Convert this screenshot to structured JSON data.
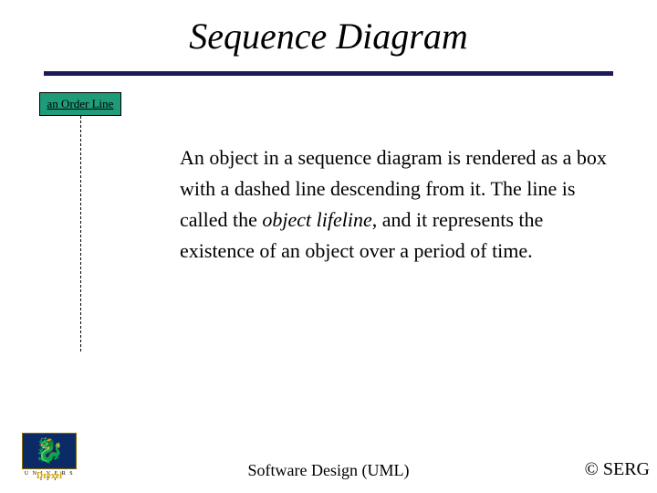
{
  "title": "Sequence Diagram",
  "object_box": {
    "label": "an Order Line"
  },
  "body": {
    "t1": "An object in a sequence diagram is rendered as a box with a dashed line descending from it. The line is called the ",
    "italic": "object lifeline",
    "t2": ", and it represents the existence of an object over a period of time."
  },
  "footer": {
    "center": "Software Design (UML)",
    "right": "© SERG"
  },
  "logo": {
    "brand": "Drexel",
    "sub": "U N I V E R S I T Y"
  }
}
